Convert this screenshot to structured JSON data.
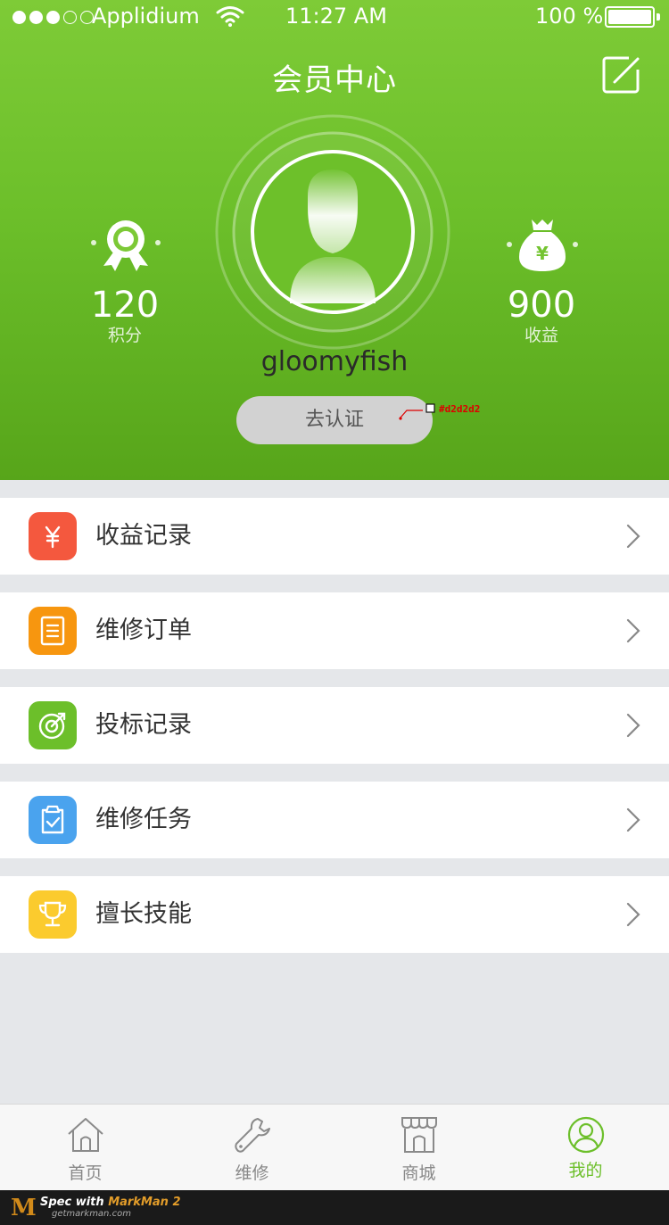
{
  "status_bar": {
    "carrier": "Applidium",
    "time": "11:27 AM",
    "battery_percent": "100 %",
    "battery_level": 1.0,
    "signal_filled": 3,
    "signal_total": 5
  },
  "header": {
    "title": "会员中心",
    "edit_icon": "edit-icon",
    "username": "gloomyfish",
    "verify_button": "去认证",
    "verify_button_color": "#d2d2d2",
    "spec_note": "#d2d2d2",
    "gradient_top": "#7ecb37",
    "gradient_bottom": "#57a51a"
  },
  "stats": {
    "points": {
      "value": "120",
      "label": "积分",
      "icon": "ribbon-medal-icon"
    },
    "income": {
      "value": "900",
      "label": "收益",
      "icon": "money-bag-icon"
    }
  },
  "menu": [
    {
      "label": "收益记录",
      "icon": "yen-icon",
      "color": "#f4583e"
    },
    {
      "label": "维修订单",
      "icon": "document-icon",
      "color": "#f7960f"
    },
    {
      "label": "投标记录",
      "icon": "target-icon",
      "color": "#6cbf2a"
    },
    {
      "label": "维修任务",
      "icon": "clipboard-check-icon",
      "color": "#4aa3ee"
    },
    {
      "label": "擅长技能",
      "icon": "trophy-icon",
      "color": "#fbcb2e"
    }
  ],
  "tabbar": [
    {
      "label": "首页",
      "icon": "home-icon",
      "active": false
    },
    {
      "label": "维修",
      "icon": "wrench-icon",
      "active": false
    },
    {
      "label": "商城",
      "icon": "store-icon",
      "active": false
    },
    {
      "label": "我的",
      "icon": "user-circle-icon",
      "active": true
    }
  ],
  "footer": {
    "spec_text_prefix": "Spec with ",
    "spec_text_brand": "MarkMan 2",
    "spec_url": "getmarkman.com",
    "logo": "M"
  },
  "colors": {
    "accent": "#6cbf2a",
    "background": "#e5e7ea"
  }
}
